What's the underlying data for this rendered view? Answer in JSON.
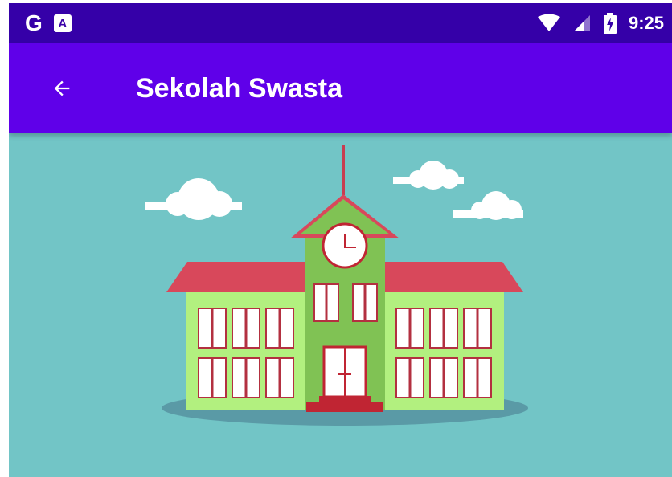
{
  "status_bar": {
    "time": "9:25",
    "left_icons": [
      "google-icon",
      "translate-icon"
    ],
    "right_icons": [
      "wifi-icon",
      "cellular-signal-icon",
      "battery-charging-icon"
    ],
    "google_glyph": "G",
    "translate_glyph": "A"
  },
  "app_bar": {
    "title": "Sekolah Swasta",
    "back_icon": "arrow-back-icon"
  },
  "hero": {
    "illustration": "school-building-illustration"
  },
  "colors": {
    "status_bar": "#3500a8",
    "app_bar": "#5f00e9",
    "on_primary": "#ffffff",
    "hero_background": "#72c5c6",
    "roof": "#d8485b",
    "tower": "#80c254",
    "wing": "#b2f07f",
    "door_steps": "#c02533",
    "window": "#ffffff",
    "window_frame": "#b33040",
    "shadow": "#5a9aa6",
    "cloud": "#ffffff"
  }
}
